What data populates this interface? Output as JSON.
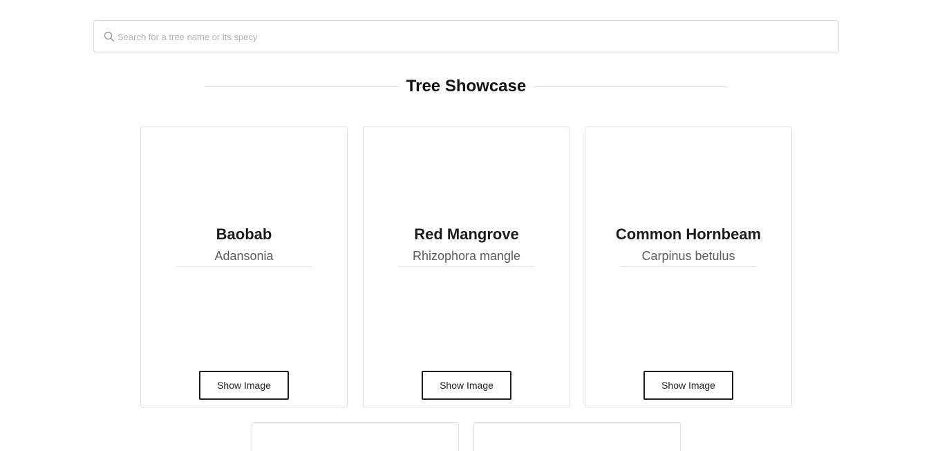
{
  "search": {
    "placeholder": "Search for a tree name or its specy",
    "value": "",
    "icon": "search-icon"
  },
  "section": {
    "title": "Tree Showcase"
  },
  "trees": [
    {
      "name": "Baobab",
      "species": "Adansonia",
      "button_label": "Show Image"
    },
    {
      "name": "Red Mangrove",
      "species": "Rhizophora mangle",
      "button_label": "Show Image"
    },
    {
      "name": "Common Hornbeam",
      "species": "Carpinus betulus",
      "button_label": "Show Image"
    }
  ],
  "colors": {
    "border": "#dedede",
    "button_border": "#1c1c1c",
    "heading_line": "#d6d6d6",
    "placeholder": "#b3b3b3"
  }
}
